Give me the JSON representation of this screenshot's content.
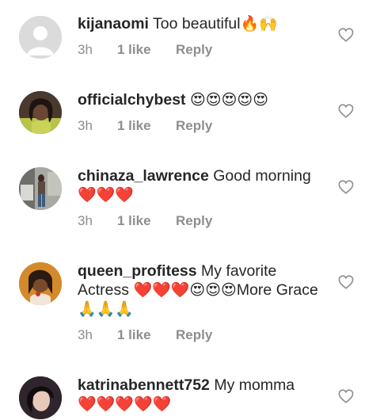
{
  "comments": [
    {
      "username": "kijanaomi",
      "text": " Too beautiful",
      "emoji": "🔥🙌",
      "time": "3h",
      "likes": "1 like",
      "reply": "Reply"
    },
    {
      "username": "officialchybest",
      "text": " ",
      "emoji": "😍😍😍😍😍",
      "time": "3h",
      "likes": "1 like",
      "reply": "Reply"
    },
    {
      "username": "chinaza_lawrence",
      "text": " Good morning",
      "emoji": "❤️❤️❤️",
      "time": "3h",
      "likes": "1 like",
      "reply": "Reply"
    },
    {
      "username": "queen_profitess",
      "text": " My favorite Actress ",
      "emoji": "❤️❤️❤️😍😍😍",
      "text2": "More Grace ",
      "emoji2": "🙏🙏🙏",
      "time": "3h",
      "likes": "1 like",
      "reply": "Reply"
    },
    {
      "username": "katrinabennett752",
      "text": " My momma",
      "emoji": "❤️❤️❤️❤️❤️",
      "time": "",
      "likes": "",
      "reply": ""
    }
  ],
  "colors": {
    "text": "#262626",
    "meta": "#8e8e8e",
    "heart_outline": "#8e8e8e",
    "placeholder_avatar": "#dbdbdb"
  },
  "icons": {
    "like": "heart-outline-icon",
    "placeholder_avatar": "default-user-silhouette"
  }
}
